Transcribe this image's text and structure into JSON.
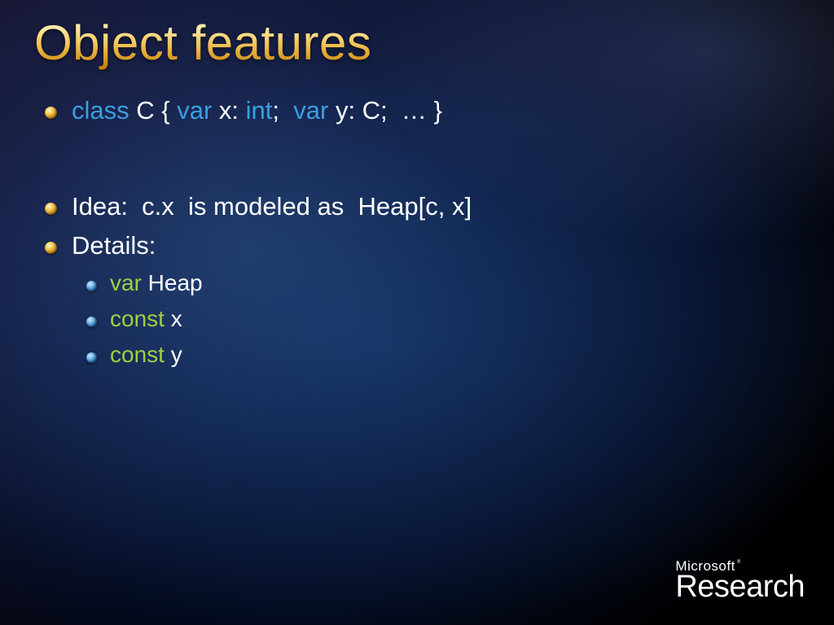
{
  "title": "Object features",
  "bullets": [
    {
      "segments": [
        {
          "text": "class",
          "cls": "kw-blue"
        },
        {
          "text": " C { ",
          "cls": "text-white"
        },
        {
          "text": "var",
          "cls": "kw-blue"
        },
        {
          "text": " x: ",
          "cls": "text-white"
        },
        {
          "text": "int",
          "cls": "kw-blue"
        },
        {
          "text": ";  ",
          "cls": "text-white"
        },
        {
          "text": "var",
          "cls": "kw-blue"
        },
        {
          "text": " y: C;  … }",
          "cls": "text-white"
        }
      ],
      "spacingClass": "first"
    },
    {
      "segments": [
        {
          "text": "Idea:  c.x  is modeled as  Heap[c, x]",
          "cls": "text-white"
        }
      ],
      "spacingClass": "reg"
    },
    {
      "segments": [
        {
          "text": "Details:",
          "cls": "text-white"
        }
      ],
      "spacingClass": "reg",
      "sub": [
        {
          "segments": [
            {
              "text": "var",
              "cls": "kw-green"
            },
            {
              "text": " Heap",
              "cls": "text-white"
            }
          ]
        },
        {
          "segments": [
            {
              "text": "const",
              "cls": "kw-green"
            },
            {
              "text": " x",
              "cls": "text-white"
            }
          ]
        },
        {
          "segments": [
            {
              "text": "const",
              "cls": "kw-green"
            },
            {
              "text": " y",
              "cls": "text-white"
            }
          ]
        }
      ]
    }
  ],
  "logo": {
    "top": "Microsoft",
    "tm": "®",
    "bottom": "Research"
  }
}
